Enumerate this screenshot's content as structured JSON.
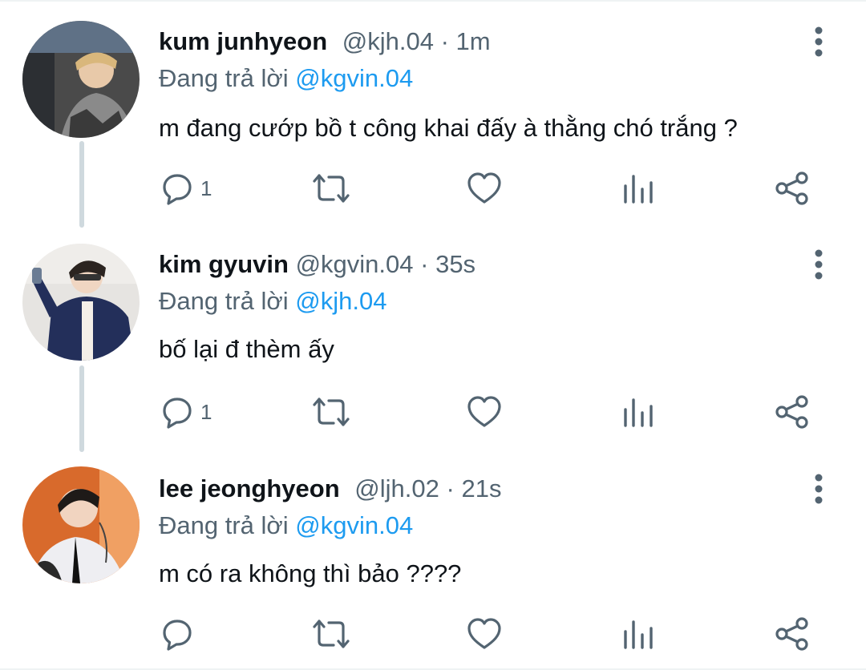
{
  "reply_prefix": "Đang trả lời",
  "tweets": [
    {
      "name": "kum junhyeon",
      "handle": "@kjh.04",
      "separator": "·",
      "time": "1m",
      "reply_to": "@kgvin.04",
      "text": "m đang cướp bồ t công khai đấy à thằng chó trắng ?",
      "reply_count": "1"
    },
    {
      "name": "kim gyuvin",
      "handle": "@kgvin.04",
      "separator": "·",
      "time": "35s",
      "reply_to": "@kjh.04",
      "text": "bố lại đ thèm ấy",
      "reply_count": "1"
    },
    {
      "name": "lee jeonghyeon",
      "handle": "@ljh.02",
      "separator": "·",
      "time": "21s",
      "reply_to": "@kgvin.04",
      "text": "m có ra không thì bảo ????",
      "reply_count": ""
    }
  ],
  "icons": {
    "more": "more-vertical-icon",
    "reply": "comment-icon",
    "retweet": "retweet-icon",
    "like": "heart-icon",
    "views": "analytics-icon",
    "share": "share-icon"
  },
  "colors": {
    "text": "#0f1419",
    "secondary": "#536471",
    "accent": "#1d9bf0",
    "thread": "#cfd9de"
  }
}
